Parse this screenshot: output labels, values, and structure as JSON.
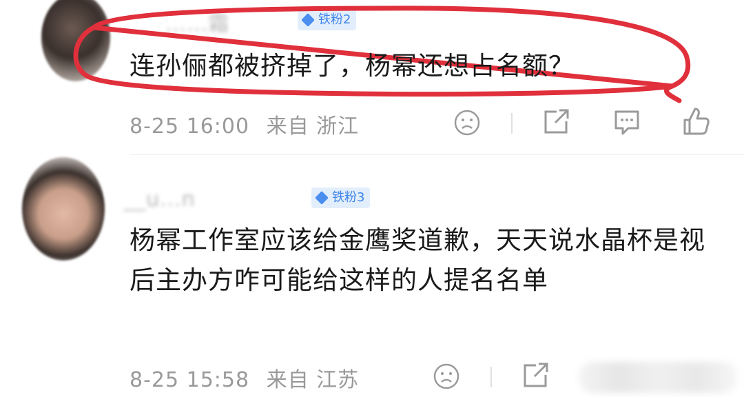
{
  "comments": [
    {
      "username": "……霜",
      "badge": "铁粉2",
      "text": "连孙俪都被挤掉了，杨幂还想占名额？",
      "date": "8-25 16:00",
      "location": "来自 浙江"
    },
    {
      "username": "__u...n",
      "badge": "铁粉3",
      "text": "杨幂工作室应该给金鹰奖道歉，天天说水晶杯是视后主办方咋可能给这样的人提名名单",
      "date": "8-25 15:58",
      "location": "来自 江苏"
    }
  ],
  "icons": {
    "dislike": "sad-face-icon",
    "share": "share-icon",
    "comment": "comment-icon",
    "like": "thumbs-up-icon"
  },
  "colors": {
    "badge_bg": "#e3eefc",
    "badge_text": "#3f86ea",
    "highlight": "#e0303c",
    "meta": "#999999"
  }
}
